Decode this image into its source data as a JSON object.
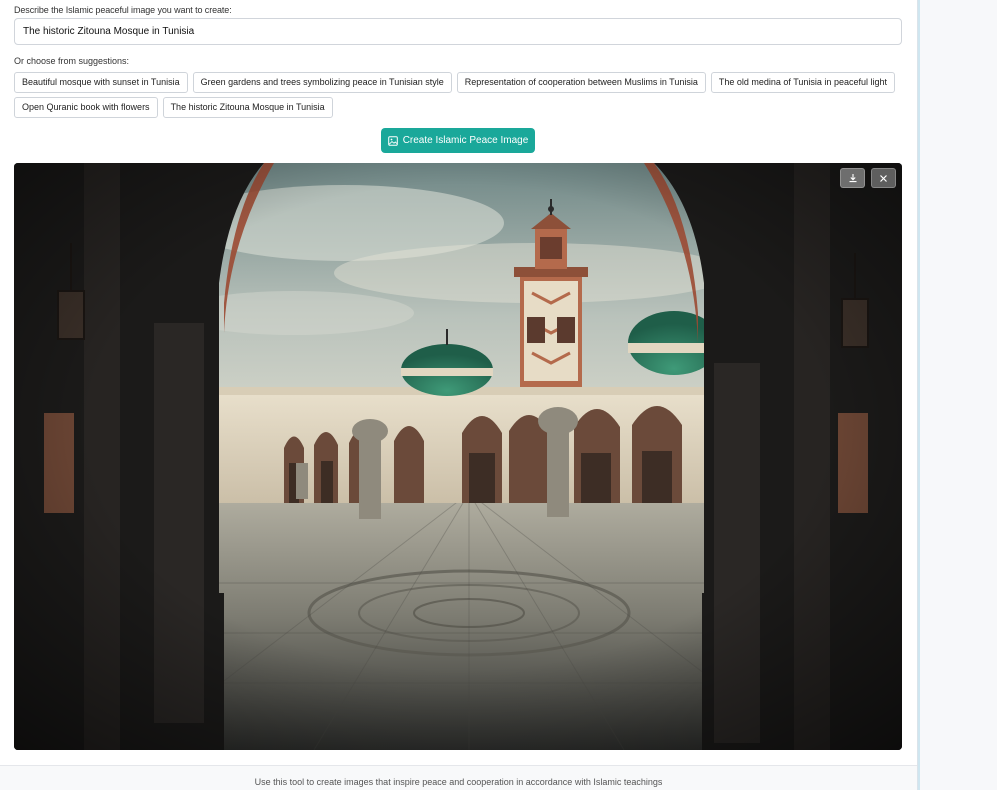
{
  "form": {
    "prompt_label": "Describe the Islamic peaceful image you want to create:",
    "prompt_value": "The historic Zitouna Mosque in Tunisia",
    "suggestions_label": "Or choose from suggestions:",
    "suggestions": [
      "Beautiful mosque with sunset in Tunisia",
      "Green gardens and trees symbolizing peace in Tunisian style",
      "Representation of cooperation between Muslims in Tunisia",
      "The old medina of Tunisia in peaceful light",
      "Open Quranic book with flowers",
      "The historic Zitouna Mosque in Tunisia"
    ],
    "create_button_label": "Create Islamic Peace Image",
    "create_button_icon": "image-icon"
  },
  "result": {
    "image_subject": "generated-mosque-courtyard-image",
    "download_icon": "download-icon",
    "close_icon": "close-icon"
  },
  "footer": {
    "text": "Use this tool to create images that inspire peace and cooperation in accordance with Islamic teachings"
  },
  "colors": {
    "accent": "#1aa89a",
    "dome": "#2f8a6a",
    "minaret_brick": "#b46a4c"
  }
}
